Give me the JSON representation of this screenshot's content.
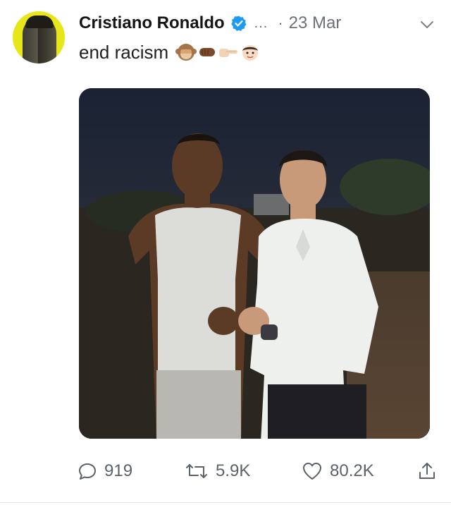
{
  "tweet": {
    "author_name": "Cristiano Ronaldo",
    "handle_truncated": "...",
    "separator": "·",
    "date": "23 Mar",
    "text": "end racism",
    "emojis": [
      "see-no-evil-monkey",
      "fist-bump-dark",
      "pointing-right-light",
      "boy-face"
    ],
    "verified": true
  },
  "actions": {
    "replies": "919",
    "retweets": "5.9K",
    "likes": "80.2K"
  },
  "icons": {
    "avatar": "profile-avatar",
    "verified": "verified-badge-icon",
    "more": "chevron-down-icon",
    "reply": "reply-bubble-icon",
    "retweet": "retweet-icon",
    "like": "heart-icon",
    "share": "share-icon"
  },
  "colors": {
    "verified_blue": "#1d9bf0",
    "icon_gray": "#5c6268",
    "avatar_bg": "#e6e619"
  }
}
